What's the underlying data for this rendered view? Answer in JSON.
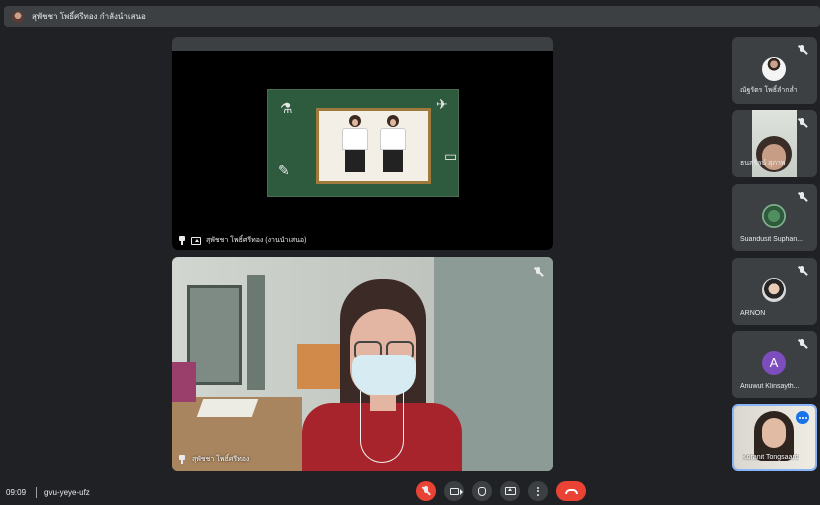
{
  "topbar": {
    "title": "สุพัชชา โพธิ์ศรีทอง กำลังนำเสนอ"
  },
  "presentation": {
    "label": "สุพัชชา โพธิ์ศรีทอง (งานนำเสนอ)"
  },
  "main_speaker": {
    "name": "สุพัชชา โพธิ์ศรีทอง"
  },
  "participants": [
    {
      "name": "ณัฐรัตร โพธิ์ลำกล่ำ"
    },
    {
      "name": "ธนสรัลน์ สุภาพ"
    },
    {
      "name": "Suandusit Suphan..."
    },
    {
      "name": "ARNON"
    },
    {
      "name": "Anuwut Klinsayth...",
      "initial": "A"
    },
    {
      "name": "Koranit Tongsaard"
    }
  ],
  "footer": {
    "time": "09:09",
    "meeting_code": "gvu-yeye-ufz"
  },
  "colors": {
    "background": "#202124",
    "tile": "#3c4043",
    "danger": "#ea4335",
    "accent": "#1a73e8",
    "self_border": "#8ab4f8"
  }
}
